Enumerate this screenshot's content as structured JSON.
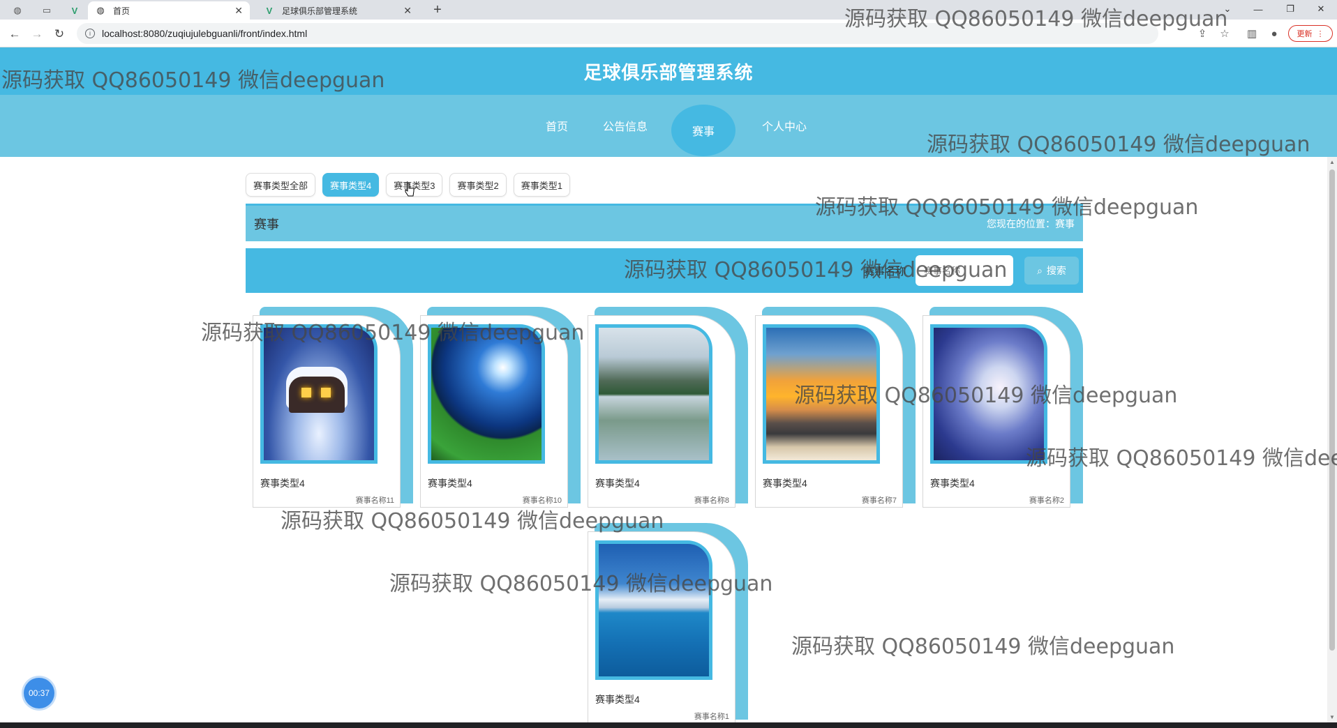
{
  "browser": {
    "tabs": [
      {
        "title": "首页",
        "icon": "globe-icon",
        "active": true
      },
      {
        "title": "足球俱乐部管理系统",
        "icon": "vue-icon",
        "active": false
      }
    ],
    "url": "localhost:8080/zuqiujulebguanli/front/index.html",
    "update_label": "更新"
  },
  "site": {
    "title": "足球俱乐部管理系统",
    "nav": [
      {
        "label": "首页",
        "active": false
      },
      {
        "label": "公告信息",
        "active": false
      },
      {
        "label": "赛事",
        "active": true
      },
      {
        "label": "个人中心",
        "active": false
      }
    ]
  },
  "filters": [
    {
      "label": "赛事类型全部",
      "active": false
    },
    {
      "label": "赛事类型4",
      "active": true
    },
    {
      "label": "赛事类型3",
      "active": false
    },
    {
      "label": "赛事类型2",
      "active": false
    },
    {
      "label": "赛事类型1",
      "active": false
    }
  ],
  "section": {
    "title": "赛事",
    "breadcrumb": "您现在的位置：赛事"
  },
  "search": {
    "label": "赛事名称",
    "placeholder": "赛事名称",
    "button_label": "搜索"
  },
  "cards": [
    {
      "category": "赛事类型4",
      "name": "赛事名称11",
      "image": "snow-house"
    },
    {
      "category": "赛事类型4",
      "name": "赛事名称10",
      "image": "moon-meadow"
    },
    {
      "category": "赛事类型4",
      "name": "赛事名称8",
      "image": "mountain-lake"
    },
    {
      "category": "赛事类型4",
      "name": "赛事名称7",
      "image": "sunset-beach"
    },
    {
      "category": "赛事类型4",
      "name": "赛事名称2",
      "image": "anime-sky"
    },
    {
      "category": "赛事类型4",
      "name": "赛事名称1",
      "image": "sea-mountains"
    }
  ],
  "watermark": "源码获取 QQ86050149 微信deepguan",
  "timer": "00:37",
  "colors": {
    "primary": "#45b9e2",
    "secondary": "#6cc6e2"
  }
}
